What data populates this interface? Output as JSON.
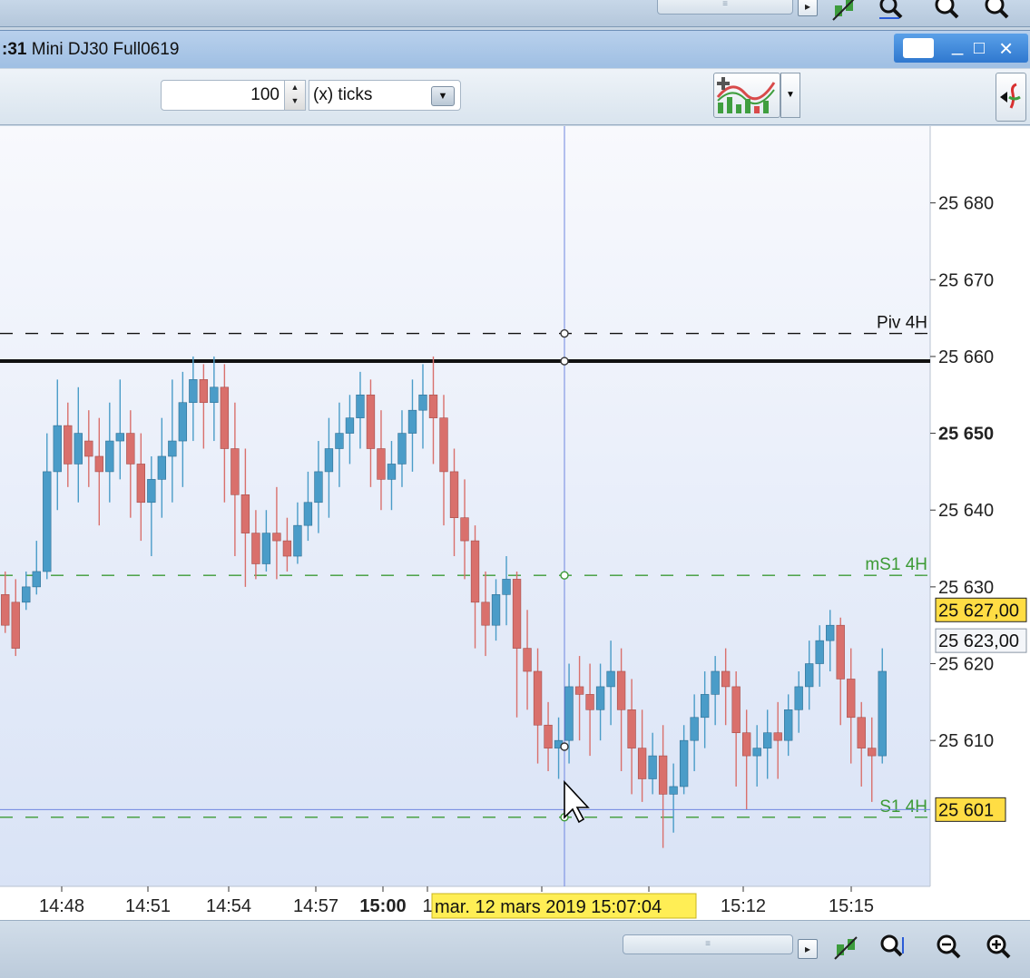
{
  "window": {
    "title_prefix": ":31",
    "title": "Mini DJ30 Full0619",
    "minimize_glyph": "_",
    "maximize_glyph": "□",
    "close_glyph": "×"
  },
  "toolbar": {
    "period_value": "100",
    "period_unit": "(x) ticks",
    "indicator_icon": "add-indicator-icon",
    "side_icon": "side-panel-toggle-icon"
  },
  "colors": {
    "bull": "#4a9cc8",
    "bear": "#d9706c",
    "plot_bg_top": "#f8f9fd",
    "plot_bg_bottom": "#d9e3f6",
    "pivot_green": "#3c9a35",
    "crosshair": "#6e86e0",
    "label_yellow": "#ffee55",
    "highlight_box": "#ffdd44"
  },
  "chart_data": {
    "type": "candlestick",
    "ylim": [
      25591,
      25690
    ],
    "y_ticks": [
      {
        "value": 25680,
        "label": "25 680",
        "bold": false
      },
      {
        "value": 25670,
        "label": "25 670",
        "bold": false
      },
      {
        "value": 25660,
        "label": "25 660",
        "bold": false
      },
      {
        "value": 25650,
        "label": "25 650",
        "bold": true
      },
      {
        "value": 25640,
        "label": "25 640",
        "bold": false
      },
      {
        "value": 25630,
        "label": "25 630",
        "bold": false
      },
      {
        "value": 25620,
        "label": "25 620",
        "bold": false
      },
      {
        "value": 25610,
        "label": "25 610",
        "bold": false
      }
    ],
    "x_ticks": [
      {
        "label": "14:48",
        "bold": false
      },
      {
        "label": "14:51",
        "bold": false
      },
      {
        "label": "14:54",
        "bold": false
      },
      {
        "label": "14:57",
        "bold": false
      },
      {
        "label": "15:00",
        "bold": true
      },
      {
        "label": "1",
        "bold": false
      },
      {
        "label": "15:12",
        "bold": false
      },
      {
        "label": "15:15",
        "bold": false
      }
    ],
    "crosshair_time_label": "mar. 12 mars 2019 15:07:04",
    "price_markers": [
      {
        "value": 25627,
        "label": "25 627,00",
        "style": "yellow"
      },
      {
        "value": 25623,
        "label": "25 623,00",
        "style": "white"
      },
      {
        "value": 25601,
        "label": "25 601",
        "style": "yellow"
      }
    ],
    "levels": [
      {
        "name": "Piv 4H",
        "value": 25663,
        "style": "dashed-black"
      },
      {
        "name": "",
        "value": 25659.4,
        "style": "solid-black"
      },
      {
        "name": "mS1 4H",
        "value": 25631.5,
        "style": "dashed-green"
      },
      {
        "name": "S1 4H",
        "value": 25600,
        "style": "dashed-green"
      }
    ],
    "crosshair_price": 25601,
    "candles": [
      [
        25629,
        25632,
        25625,
        25624
      ],
      [
        25628,
        25631,
        25622,
        25621
      ],
      [
        25628,
        25632,
        25630,
        25627
      ],
      [
        25630,
        25636,
        25632,
        25629
      ],
      [
        25632,
        25650,
        25645,
        25631
      ],
      [
        25645,
        25657,
        25651,
        25640
      ],
      [
        25651,
        25654,
        25646,
        25643
      ],
      [
        25646,
        25656,
        25650,
        25641
      ],
      [
        25649,
        25653,
        25647,
        25643
      ],
      [
        25647,
        25652,
        25645,
        25638
      ],
      [
        25645,
        25654,
        25649,
        25641
      ],
      [
        25649,
        25657,
        25650,
        25644
      ],
      [
        25650,
        25653,
        25646,
        25639
      ],
      [
        25646,
        25650,
        25641,
        25636
      ],
      [
        25641,
        25647,
        25644,
        25634
      ],
      [
        25644,
        25652,
        25647,
        25639
      ],
      [
        25647,
        25657,
        25649,
        25641
      ],
      [
        25649,
        25658,
        25654,
        25643
      ],
      [
        25654,
        25660,
        25657,
        25649
      ],
      [
        25657,
        25659,
        25654,
        25648
      ],
      [
        25654,
        25660,
        25656,
        25649
      ],
      [
        25656,
        25659,
        25648,
        25641
      ],
      [
        25648,
        25654,
        25642,
        25634
      ],
      [
        25642,
        25648,
        25637,
        25630
      ],
      [
        25637,
        25640,
        25633,
        25631
      ],
      [
        25633,
        25640,
        25637,
        25632
      ],
      [
        25637,
        25643,
        25636,
        25631
      ],
      [
        25636,
        25639,
        25634,
        25632
      ],
      [
        25634,
        25641,
        25638,
        25633
      ],
      [
        25638,
        25645,
        25641,
        25636
      ],
      [
        25641,
        25649,
        25645,
        25637
      ],
      [
        25645,
        25652,
        25648,
        25639
      ],
      [
        25648,
        25654,
        25650,
        25643
      ],
      [
        25650,
        25655,
        25652,
        25646
      ],
      [
        25652,
        25658,
        25655,
        25648
      ],
      [
        25655,
        25657,
        25648,
        25643
      ],
      [
        25648,
        25653,
        25644,
        25640
      ],
      [
        25644,
        25649,
        25646,
        25640
      ],
      [
        25646,
        25653,
        25650,
        25643
      ],
      [
        25650,
        25657,
        25653,
        25645
      ],
      [
        25653,
        25659,
        25655,
        25648
      ],
      [
        25655,
        25660,
        25652,
        25646
      ],
      [
        25652,
        25655,
        25645,
        25638
      ],
      [
        25645,
        25648,
        25639,
        25634
      ],
      [
        25639,
        25644,
        25636,
        25631
      ],
      [
        25636,
        25638,
        25628,
        25622
      ],
      [
        25628,
        25632,
        25625,
        25621
      ],
      [
        25625,
        25631,
        25629,
        25623
      ],
      [
        25629,
        25634,
        25631,
        25625
      ],
      [
        25631,
        25632,
        25622,
        25613
      ],
      [
        25622,
        25627,
        25619,
        25614
      ],
      [
        25619,
        25622,
        25612,
        25607
      ],
      [
        25612,
        25615,
        25609,
        25606
      ],
      [
        25609,
        25613,
        25610,
        25605
      ],
      [
        25610,
        25620,
        25617,
        25607
      ],
      [
        25617,
        25621,
        25616,
        25610
      ],
      [
        25616,
        25620,
        25614,
        25608
      ],
      [
        25614,
        25620,
        25617,
        25610
      ],
      [
        25617,
        25623,
        25619,
        25612
      ],
      [
        25619,
        25622,
        25614,
        25606
      ],
      [
        25614,
        25618,
        25609,
        25603
      ],
      [
        25609,
        25614,
        25605,
        25602
      ],
      [
        25605,
        25611,
        25608,
        25603
      ],
      [
        25608,
        25612,
        25603,
        25596
      ],
      [
        25603,
        25607,
        25604,
        25598
      ],
      [
        25604,
        25612,
        25610,
        25603
      ],
      [
        25610,
        25616,
        25613,
        25606
      ],
      [
        25613,
        25619,
        25616,
        25609
      ],
      [
        25616,
        25621,
        25619,
        25612
      ],
      [
        25619,
        25622,
        25617,
        25612
      ],
      [
        25617,
        25619,
        25611,
        25604
      ],
      [
        25611,
        25614,
        25608,
        25601
      ],
      [
        25608,
        25612,
        25609,
        25604
      ],
      [
        25609,
        25614,
        25611,
        25605
      ],
      [
        25611,
        25615,
        25610,
        25605
      ],
      [
        25610,
        25616,
        25614,
        25608
      ],
      [
        25614,
        25619,
        25617,
        25611
      ],
      [
        25617,
        25623,
        25620,
        25614
      ],
      [
        25620,
        25625,
        25623,
        25617
      ],
      [
        25623,
        25627,
        25625,
        25619
      ],
      [
        25625,
        25626,
        25618,
        25612
      ],
      [
        25618,
        25622,
        25613,
        25607
      ],
      [
        25613,
        25615,
        25609,
        25604
      ],
      [
        25609,
        25613,
        25608,
        25602
      ],
      [
        25608,
        25622,
        25619,
        25607
      ]
    ]
  },
  "bottombar": {
    "scroll_grip": "≡",
    "scroll_arrow": "▸"
  }
}
